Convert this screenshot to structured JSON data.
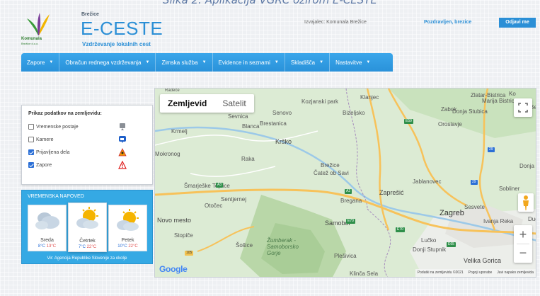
{
  "caption": "Slika 2: Aplikacija VGRC ozirom E-CESTE",
  "header": {
    "logo_name": "Komunala",
    "logo_sub": "Brežice d.o.o.",
    "region": "Brežice",
    "app_title": "E-CESTE",
    "app_subtitle": "Vzdrževanje lokalnih cest",
    "contractor": "Izvajalec: Komunala Brežice",
    "greeting": "Pozdravljen, brezice",
    "logout_label": "Odjavi me"
  },
  "nav": {
    "items": [
      {
        "label": "Zapore"
      },
      {
        "label": "Obračun rednega vzdrževanja"
      },
      {
        "label": "Zimska služba"
      },
      {
        "label": "Evidence in seznami"
      },
      {
        "label": "Skladišča"
      },
      {
        "label": "Nastavitve"
      }
    ]
  },
  "layers": {
    "title": "Prikaz podatkov na zemljevidu:",
    "items": [
      {
        "label": "Vremenske postaje",
        "checked": false,
        "icon": "weather-station-icon"
      },
      {
        "label": "Kamere",
        "checked": false,
        "icon": "camera-icon"
      },
      {
        "label": "Prijavljena dela",
        "checked": true,
        "icon": "roadwork-icon"
      },
      {
        "label": "Zapore",
        "checked": true,
        "icon": "warning-icon"
      }
    ]
  },
  "weather": {
    "title": "VREMENSKA NAPOVED",
    "days": [
      {
        "name": "Sreda",
        "min": "8°C",
        "max": "13°C",
        "icon": "cloudy-icon"
      },
      {
        "name": "Četrtek",
        "min": "7°C",
        "max": "22°C",
        "icon": "partly-sunny-icon"
      },
      {
        "name": "Petek",
        "min": "10°C",
        "max": "22°C",
        "icon": "partly-sunny-icon"
      }
    ],
    "source": "Vir: Agencija Republike Slovenije za okolje"
  },
  "map": {
    "type_buttons": [
      "Zemljevid",
      "Satelit"
    ],
    "places": [
      "Kozjanski park",
      "Klanjec",
      "Zlatar-Bistrica",
      "Zabok",
      "Marija Bistrica",
      "Oroslavje",
      "Donja Stubica",
      "Senovo",
      "Bizeljsko",
      "Sevnica",
      "Blanca",
      "Brestanica",
      "Krmelj",
      "Krško",
      "Mokronog",
      "Raka",
      "Brežice",
      "Čatež ob Savi",
      "Jablanovec",
      "Šmarješke Toplice",
      "Sentjernej",
      "Zaprešić",
      "Sesvete",
      "Sobliner",
      "Donja",
      "Otočec",
      "Bregana",
      "Novo mesto",
      "Zagreb",
      "Samobor",
      "Ivanja Reka",
      "Lučko",
      "Stopiče",
      "Žumberak - Samoborsko Gorje",
      "Šošice",
      "Plešivica",
      "Donji Stupnik",
      "Velika Gorica",
      "Klinča Sela",
      "Dug",
      "Be",
      "Ko",
      "Radeče"
    ],
    "roads": [
      "E59",
      "E70",
      "E65",
      "A2",
      "A3",
      "105",
      "E70",
      "29",
      "29"
    ],
    "attribution": [
      "Podatki na zemljevidu ©2021",
      "Pogoji uporabe",
      "Javi napako zemljevida"
    ],
    "google": "Google"
  }
}
